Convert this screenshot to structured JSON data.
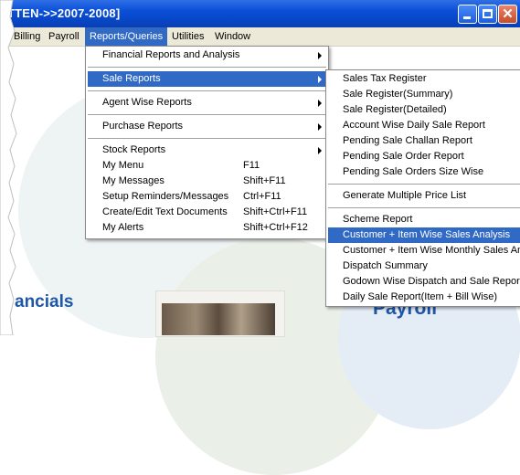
{
  "window": {
    "title": "TTEN->>2007-2008]",
    "minimize_label": "",
    "close_glyph": "✕"
  },
  "menubar": {
    "items": [
      {
        "label": "Billing"
      },
      {
        "label": "Payroll"
      },
      {
        "label": "Reports/Queries"
      },
      {
        "label": "Utilities"
      },
      {
        "label": "Window"
      }
    ]
  },
  "reports_menu": {
    "items": [
      {
        "label": "Financial Reports and Analysis",
        "submenu": true
      },
      {
        "label": "Sale Reports",
        "submenu": true
      },
      {
        "label": "Agent Wise Reports",
        "submenu": true
      },
      {
        "label": "Purchase Reports",
        "submenu": true
      },
      {
        "label": "Stock Reports",
        "submenu": true
      },
      {
        "label": "My Menu",
        "shortcut": "F11"
      },
      {
        "label": "My Messages",
        "shortcut": "Shift+F11"
      },
      {
        "label": "Setup Reminders/Messages",
        "shortcut": "Ctrl+F11"
      },
      {
        "label": "Create/Edit Text Documents",
        "shortcut": "Shift+Ctrl+F11"
      },
      {
        "label": "My Alerts",
        "shortcut": "Shift+Ctrl+F12"
      }
    ]
  },
  "sale_menu": {
    "items": [
      {
        "label": "Sales Tax Register"
      },
      {
        "label": "Sale Register(Summary)"
      },
      {
        "label": "Sale Register(Detailed)"
      },
      {
        "label": "Account Wise Daily Sale Report"
      },
      {
        "label": "Pending Sale Challan Report"
      },
      {
        "label": "Pending Sale Order Report"
      },
      {
        "label": "Pending Sale Orders Size Wise"
      },
      {
        "label": "Generate Multiple Price List"
      },
      {
        "label": "Scheme Report"
      },
      {
        "label": "Customer + Item Wise Sales Analysis"
      },
      {
        "label": "Customer + Item Wise Monthly Sales Ana"
      },
      {
        "label": "Dispatch Summary"
      },
      {
        "label": "Godown Wise Dispatch and Sale Report"
      },
      {
        "label": "Daily Sale Report(Item + Bill Wise)"
      }
    ]
  },
  "background": {
    "left_heading": "ancials",
    "right_heading": "Payroll"
  },
  "colors": {
    "titlebar": "#0a4fd6",
    "menubar": "#ece9d8",
    "highlight": "#316ac5",
    "heading": "#1e56a8"
  }
}
